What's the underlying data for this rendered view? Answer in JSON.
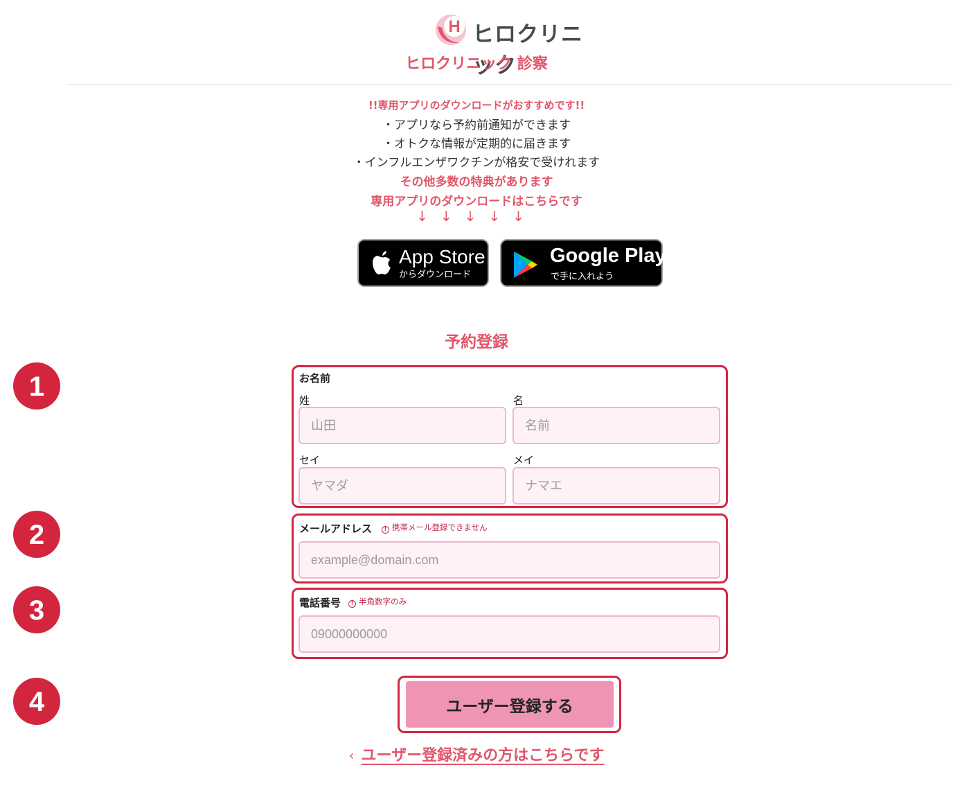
{
  "header": {
    "logo_text": "ヒロクリニック",
    "logo_letter": "H",
    "clinic_title": "ヒロクリニック 診察"
  },
  "promo": {
    "headline": "!!専用アプリのダウンロードがおすすめです!!",
    "benefits": [
      "・アプリなら予約前通知ができます",
      "・オトクな情報が定期的に届きます",
      "・インフルエンザワクチンが格安で受けれます"
    ],
    "more": "その他多数の特典があります",
    "download_here": "専用アプリのダウンロードはこちらです",
    "arrows": "↓↓↓↓↓"
  },
  "app_store": {
    "big": "App Store",
    "small": "からダウンロード",
    "icon": "apple-icon"
  },
  "google_play": {
    "big": "Google Play",
    "small": "で手に入れよう",
    "icon": "google-play-icon"
  },
  "form": {
    "title": "予約登録",
    "name_section": {
      "label": "お名前",
      "last_name_label": "姓",
      "last_name_placeholder": "山田",
      "first_name_label": "名",
      "first_name_placeholder": "名前",
      "last_kana_label": "セイ",
      "last_kana_placeholder": "ヤマダ",
      "first_kana_label": "メイ",
      "first_kana_placeholder": "ナマエ"
    },
    "email": {
      "label": "メールアドレス",
      "note": "携帯メール登録できません",
      "placeholder": "example@domain.com"
    },
    "phone": {
      "label": "電話番号",
      "note": "半角数字のみ",
      "placeholder": "09000000000"
    },
    "note_icon": "!",
    "submit_label": "ユーザー登録する",
    "login_link": "ユーザー登録済みの方はこちらです",
    "login_chevron": "‹"
  },
  "steps": [
    "1",
    "2",
    "3",
    "4"
  ],
  "colors": {
    "accent": "#e0566a",
    "highlight_border": "#d4253f",
    "input_bg": "#fff2f6",
    "input_border": "#f0b6ca",
    "button_bg": "#ee94b4"
  }
}
